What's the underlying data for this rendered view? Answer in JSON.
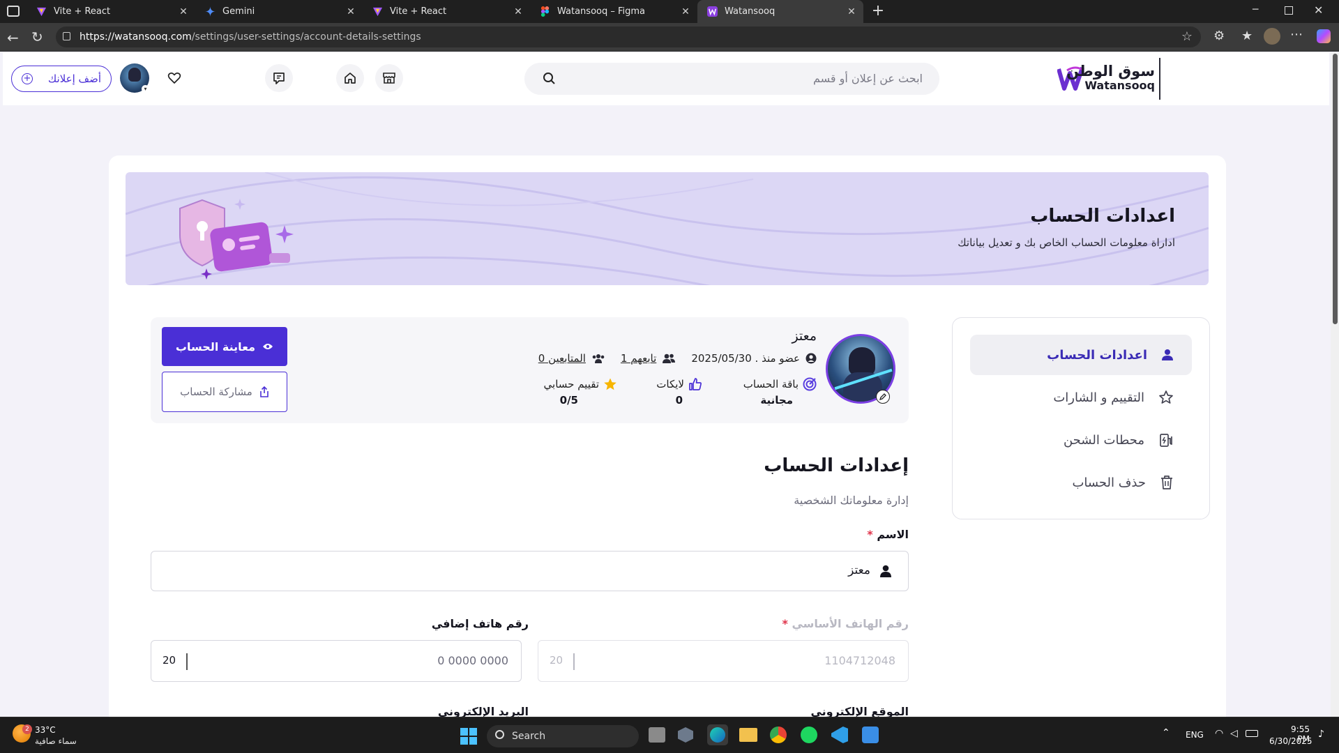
{
  "browser": {
    "tabs": [
      {
        "title": "Vite + React",
        "icon": "vite-icon",
        "active": false
      },
      {
        "title": "Gemini",
        "icon": "gemini-icon",
        "active": false
      },
      {
        "title": "Vite + React",
        "icon": "vite-icon",
        "active": false
      },
      {
        "title": "Watansooq – Figma",
        "icon": "figma-icon",
        "active": false
      },
      {
        "title": "Watansooq",
        "icon": "watansooq-icon",
        "active": true
      }
    ],
    "url_host": "https://watansooq.com",
    "url_path": "/settings/user-settings/account-details-settings"
  },
  "header": {
    "logo_ar": "سوق الوطن",
    "logo_en": "Watansooq",
    "search_placeholder": "ابحث عن إعلان أو قسم",
    "add_ad_label": "أضف إعلانك"
  },
  "banner": {
    "title": "اعدادات الحساب",
    "subtitle": "اداراة معلومات الحساب الخاص بك و تعديل بياناتك"
  },
  "sidebar": {
    "items": [
      {
        "label": "اعدادات الحساب",
        "icon": "user-icon",
        "active": true
      },
      {
        "label": "التقييم و الشارات",
        "icon": "star-icon",
        "active": false
      },
      {
        "label": "محطات الشحن",
        "icon": "charging-station-icon",
        "active": false
      },
      {
        "label": "حذف الحساب",
        "icon": "trash-icon",
        "active": false
      }
    ]
  },
  "profile": {
    "name": "معتز",
    "member_since": "عضو منذ . 2025/05/30",
    "following": "تابعهم  1",
    "followers": "المتابعين  0",
    "package_label": "باقة الحساب",
    "package_value": "مجانية",
    "likes_label": "لايكات",
    "likes_value": "0",
    "rating_label": "تقييم حسابي",
    "rating_value": "0/5",
    "preview_button": "معاينة الحساب",
    "share_button": "مشاركة الحساب"
  },
  "form": {
    "title": "إعدادات الحساب",
    "subtitle": "إدارة معلوماتك الشخصية",
    "name_label": "الاسم",
    "name_value": "معتز",
    "phone_label": "رقم الهاتف الأساسي",
    "phone_value": "1104712048",
    "phone_code": "20",
    "extra_phone_label": "رقم هاتف إضافي",
    "extra_phone_placeholder": "0 0000 0000",
    "extra_phone_code": "20",
    "website_label": "الموقع الإلكتروني",
    "email_label": "البريد الإلكتروني"
  },
  "taskbar": {
    "weather_temp": "33°C",
    "weather_desc": "سماء صافية",
    "weather_badge": "2",
    "search_label": "Search",
    "lang": "ENG",
    "time": "9:55 PM",
    "date": "6/30/2025"
  },
  "colors": {
    "primary": "#4a2fd6",
    "banner_bg": "#dcd7f5",
    "accent_purple": "#7a3fe0"
  }
}
